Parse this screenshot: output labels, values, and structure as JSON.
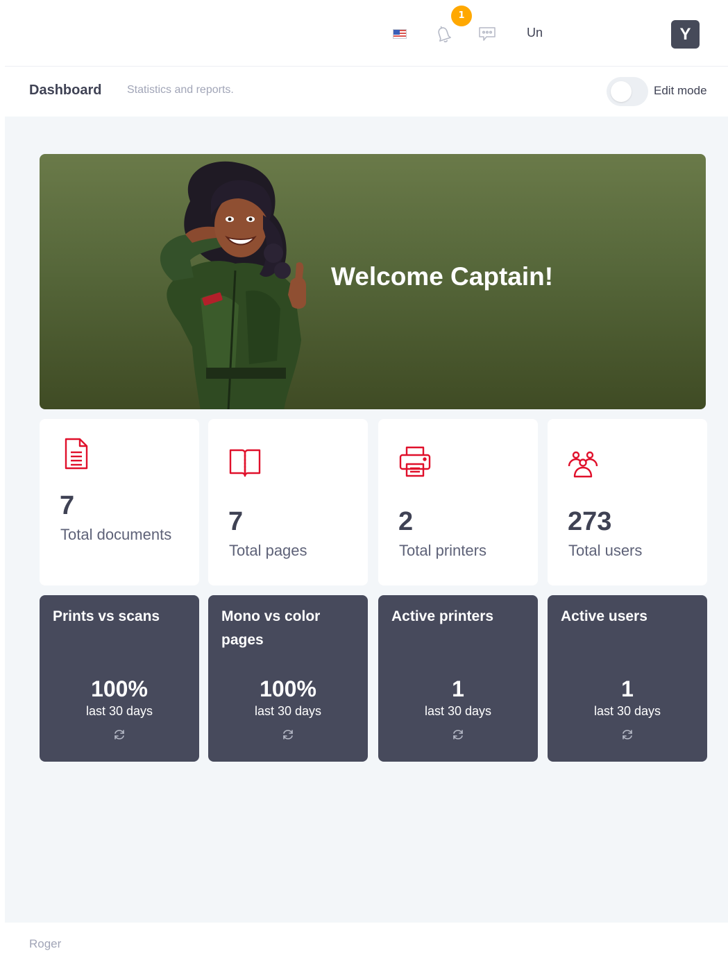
{
  "header": {
    "language_icon": "us-flag-icon",
    "notifications_icon": "bell-icon",
    "notification_count": "1",
    "messages_icon": "chat-icon",
    "username": "Un",
    "avatar_initial": "Y"
  },
  "subheader": {
    "title": "Dashboard",
    "subtitle": "Statistics and reports.",
    "edit_mode_label": "Edit mode",
    "edit_mode_on": false
  },
  "banner": {
    "greeting": "Welcome Captain!",
    "illustration": "saluting-captain-illustration"
  },
  "stats": [
    {
      "icon": "document-icon",
      "value": "7",
      "label": "Total documents"
    },
    {
      "icon": "book-icon",
      "value": "7",
      "label": "Total pages"
    },
    {
      "icon": "printer-icon",
      "value": "2",
      "label": "Total printers"
    },
    {
      "icon": "users-icon",
      "value": "273",
      "label": "Total users"
    }
  ],
  "metrics": [
    {
      "title": "Prints vs scans",
      "value": "100%",
      "period": "last 30 days",
      "icon": "refresh-icon"
    },
    {
      "title": "Mono vs color pages",
      "value": "100%",
      "period": "last 30 days",
      "icon": "refresh-icon"
    },
    {
      "title": "Active printers",
      "value": "1",
      "period": "last 30 days",
      "icon": "refresh-icon"
    },
    {
      "title": "Active users",
      "value": "1",
      "period": "last 30 days",
      "icon": "refresh-icon"
    }
  ],
  "footer": {
    "text": "Roger"
  },
  "colors": {
    "accent": "#e0102b",
    "badge": "#ffa800",
    "dark_card": "#474a5c",
    "banner_green": "#5c6d3f"
  }
}
